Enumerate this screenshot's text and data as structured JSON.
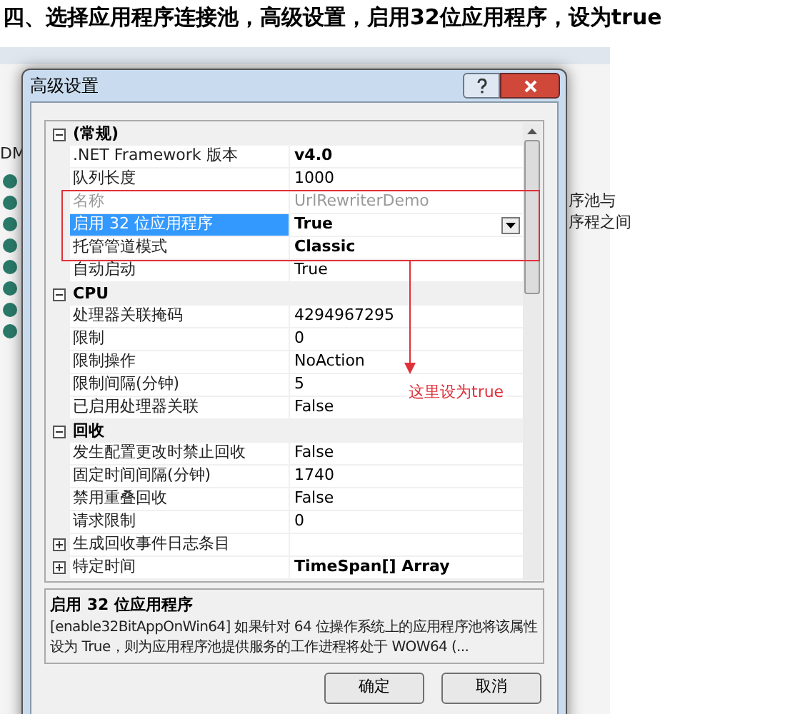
{
  "heading": "四、选择应用程序连接池，高级设置，启用32位应用程序，设为true",
  "background": {
    "left_texts": [
      "DM"
    ],
    "right_texts": [
      "序池与",
      "序程之间"
    ]
  },
  "dialog": {
    "title": "高级设置",
    "grid": [
      {
        "kind": "section",
        "name": "(常规)",
        "expanded": true,
        "rows": [
          {
            "name": ".NET Framework 版本",
            "value": "v4.0",
            "bold": true,
            "disabled": false,
            "selected": false
          },
          {
            "name": "队列长度",
            "value": "1000",
            "bold": false,
            "disabled": false,
            "selected": false
          },
          {
            "name": "名称",
            "value": "UrlRewriterDemo",
            "bold": false,
            "disabled": true,
            "selected": false
          },
          {
            "name": "启用 32 位应用程序",
            "value": "True",
            "bold": true,
            "disabled": false,
            "selected": true
          },
          {
            "name": "托管管道模式",
            "value": "Classic",
            "bold": true,
            "disabled": false,
            "selected": false
          },
          {
            "name": "自动启动",
            "value": "True",
            "bold": false,
            "disabled": false,
            "selected": false
          }
        ]
      },
      {
        "kind": "section",
        "name": "CPU",
        "expanded": true,
        "rows": [
          {
            "name": "处理器关联掩码",
            "value": "4294967295",
            "bold": false,
            "disabled": false,
            "selected": false
          },
          {
            "name": "限制",
            "value": "0",
            "bold": false,
            "disabled": false,
            "selected": false
          },
          {
            "name": "限制操作",
            "value": "NoAction",
            "bold": false,
            "disabled": false,
            "selected": false
          },
          {
            "name": "限制间隔(分钟)",
            "value": "5",
            "bold": false,
            "disabled": false,
            "selected": false
          },
          {
            "name": "已启用处理器关联",
            "value": "False",
            "bold": false,
            "disabled": false,
            "selected": false
          }
        ]
      },
      {
        "kind": "section",
        "name": "回收",
        "expanded": true,
        "rows": [
          {
            "name": "发生配置更改时禁止回收",
            "value": "False",
            "bold": false,
            "disabled": false,
            "selected": false
          },
          {
            "name": "固定时间间隔(分钟)",
            "value": "1740",
            "bold": false,
            "disabled": false,
            "selected": false
          },
          {
            "name": "禁用重叠回收",
            "value": "False",
            "bold": false,
            "disabled": false,
            "selected": false
          },
          {
            "name": "请求限制",
            "value": "0",
            "bold": false,
            "disabled": false,
            "selected": false
          },
          {
            "name": "生成回收事件日志条目",
            "expanded": false,
            "disabled": false,
            "selected": false
          },
          {
            "name": "特定时间",
            "value": "TimeSpan[] Array",
            "expanded": false,
            "bold": true,
            "disabled": false,
            "selected": false
          }
        ]
      }
    ],
    "description": {
      "title": "启用 32 位应用程序",
      "text": "[enable32BitAppOnWin64] 如果针对 64 位操作系统上的应用程序池将该属性设为 True，则为应用程序池提供服务的工作进程将处于 WOW64 (..."
    },
    "buttons": [
      "确定",
      "取消"
    ]
  },
  "annotation": {
    "note": "这里设为true"
  }
}
